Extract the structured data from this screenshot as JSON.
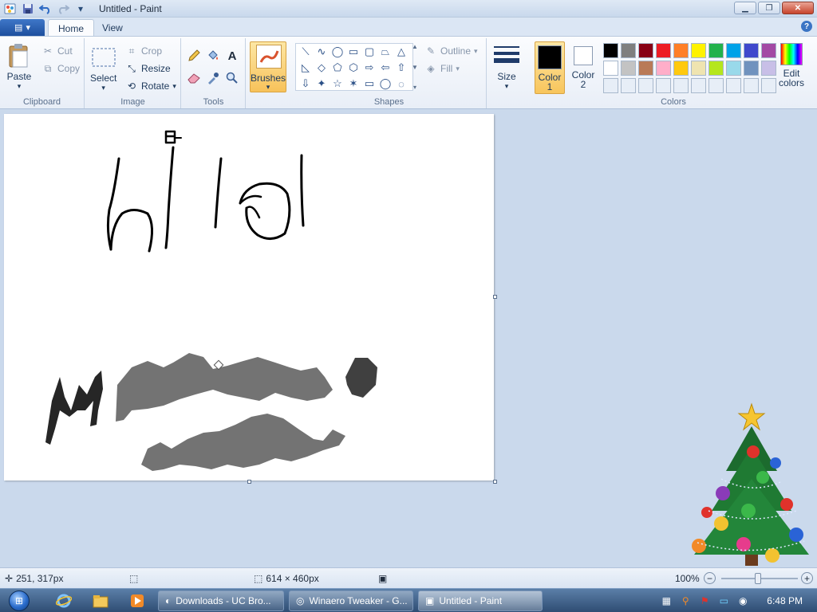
{
  "window": {
    "title": "Untitled - Paint"
  },
  "qat": {
    "save_icon": "save-icon",
    "undo_icon": "undo-icon",
    "redo_icon": "redo-icon",
    "customize_icon": "chevron-down-icon"
  },
  "tabs": {
    "file_menu_icon": "file-menu-icon",
    "home": "Home",
    "view": "View"
  },
  "clipboard": {
    "paste": "Paste",
    "cut": "Cut",
    "copy": "Copy",
    "label": "Clipboard"
  },
  "image": {
    "select": "Select",
    "crop": "Crop",
    "resize": "Resize",
    "rotate": "Rotate",
    "label": "Image"
  },
  "tools": {
    "label": "Tools"
  },
  "brushes": {
    "label": "Brushes"
  },
  "shapes": {
    "label": "Shapes",
    "outline": "Outline",
    "fill": "Fill",
    "items": [
      "⟍",
      "∿",
      "◯",
      "▭",
      "▢",
      "⏢",
      "△",
      "◺",
      "◇",
      "⬠",
      "⬡",
      "⇨",
      "⇦",
      "⇧",
      "⇩",
      "✦",
      "☆",
      "✶",
      "▭",
      "◯",
      "◌"
    ]
  },
  "size": {
    "label": "Size"
  },
  "colors": {
    "color1_label_a": "Color",
    "color1_label_b": "1",
    "color2_label_a": "Color",
    "color2_label_b": "2",
    "edit_a": "Edit",
    "edit_b": "colors",
    "label": "Colors",
    "color1": "#000000",
    "color2": "#ffffff",
    "palette": [
      "#000000",
      "#7f7f7f",
      "#880015",
      "#ed1c24",
      "#ff7f27",
      "#fff200",
      "#22b14c",
      "#00a2e8",
      "#3f48cc",
      "#a349a4",
      "#ffffff",
      "#c3c3c3",
      "#b97a57",
      "#ffaec9",
      "#ffc90e",
      "#efe4b0",
      "#b5e61d",
      "#99d9ea",
      "#7092be",
      "#c8bfe7",
      "#e7eef7",
      "#e7eef7",
      "#e7eef7",
      "#e7eef7",
      "#e7eef7",
      "#e7eef7",
      "#e7eef7",
      "#e7eef7",
      "#e7eef7",
      "#e7eef7"
    ]
  },
  "status": {
    "cursor": "251, 317px",
    "dimensions": "614 × 460px",
    "zoom": "100%"
  },
  "taskbar": {
    "tasks": [
      {
        "label": "Downloads - UC Bro...",
        "icon": "uc-browser-icon"
      },
      {
        "label": "Winaero Tweaker - G...",
        "icon": "chrome-icon"
      },
      {
        "label": "Untitled - Paint",
        "icon": "paint-icon"
      }
    ],
    "clock": "6:48 PM"
  }
}
